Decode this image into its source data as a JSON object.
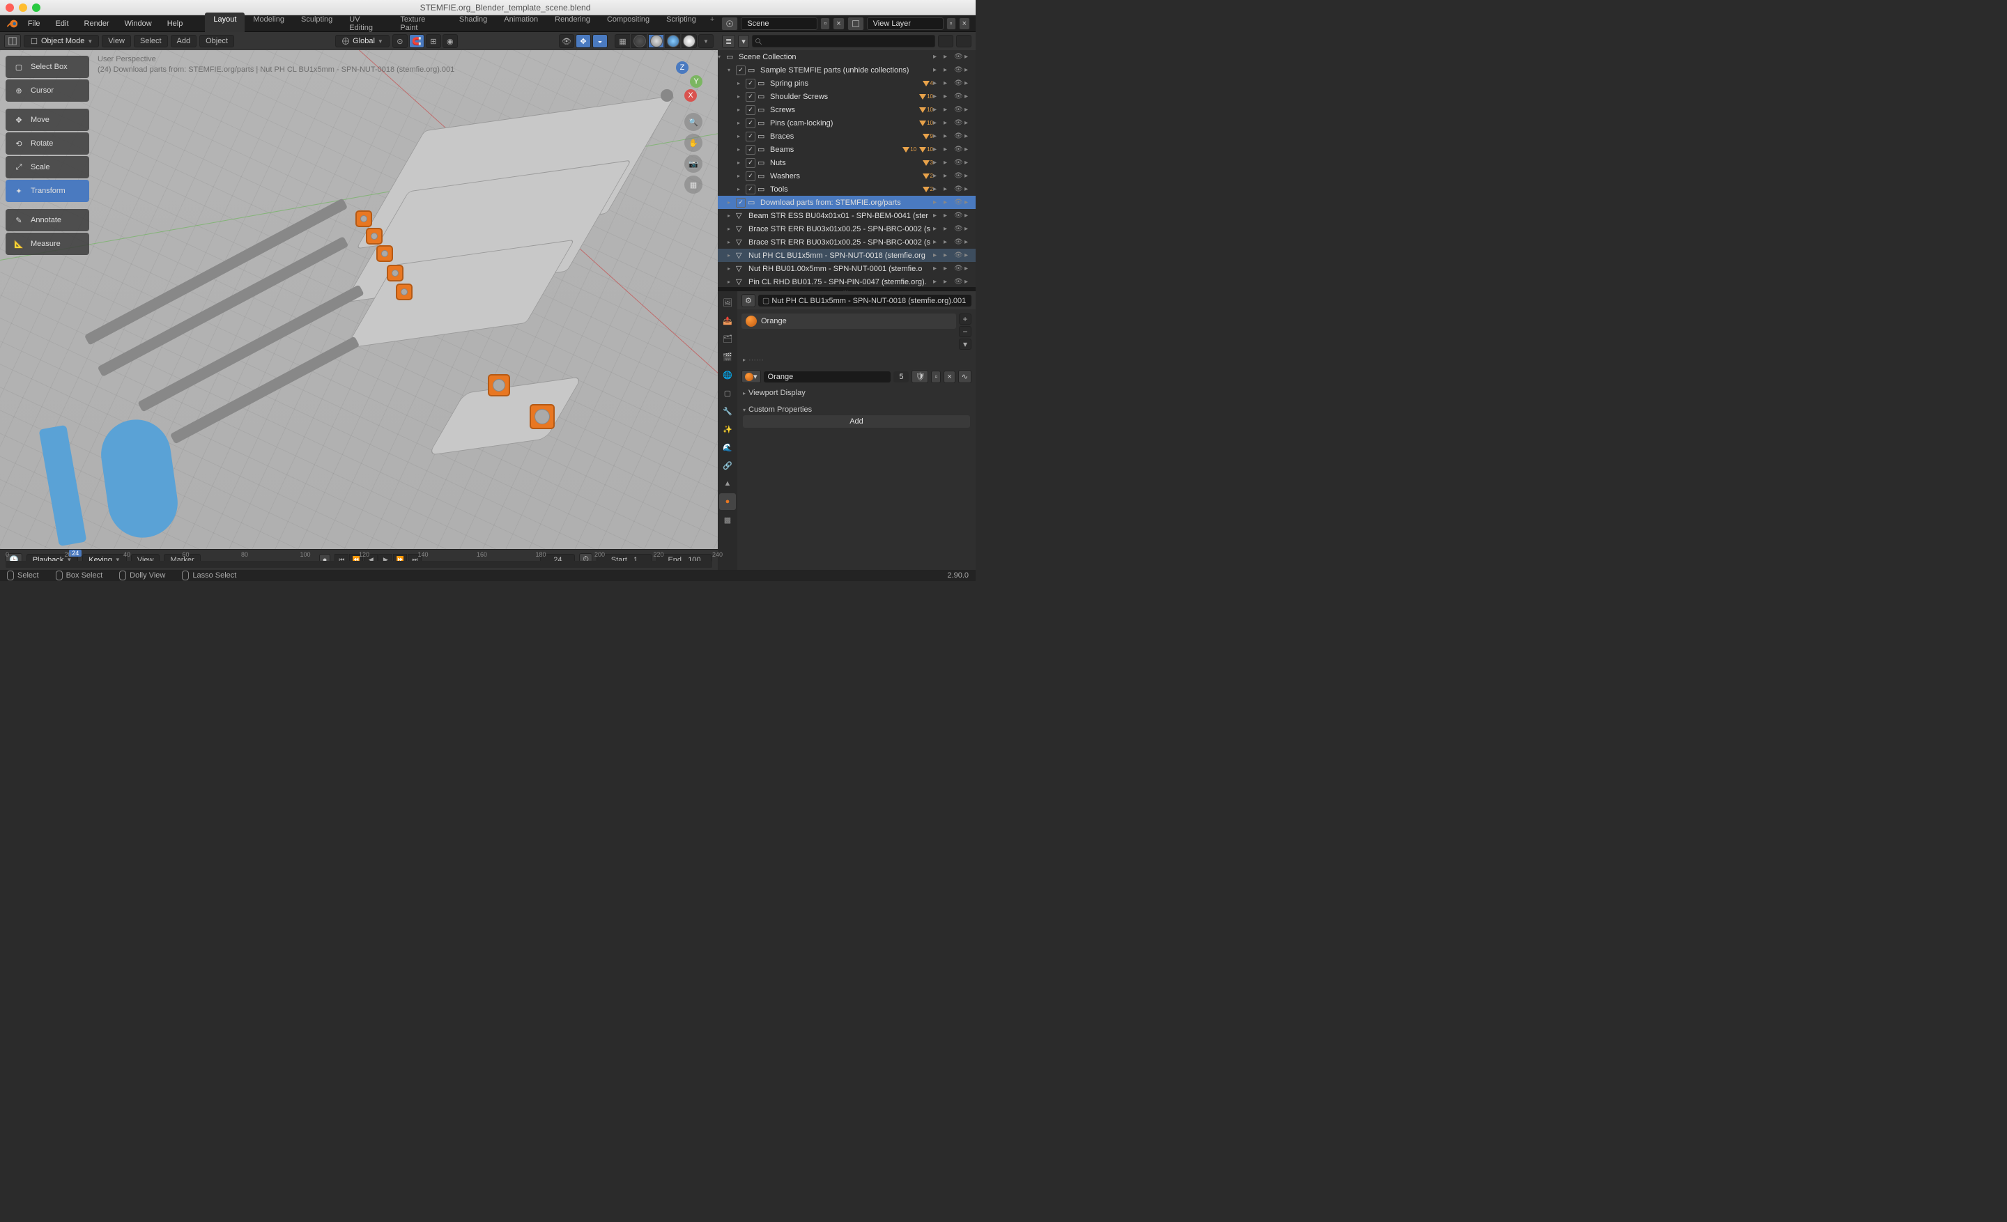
{
  "title": "STEMFIE.org_Blender_template_scene.blend",
  "menu": [
    "File",
    "Edit",
    "Render",
    "Window",
    "Help"
  ],
  "workspaces": {
    "items": [
      "Layout",
      "Modeling",
      "Sculpting",
      "UV Editing",
      "Texture Paint",
      "Shading",
      "Animation",
      "Rendering",
      "Compositing",
      "Scripting"
    ],
    "active": "Layout",
    "add": "+"
  },
  "scene": {
    "label": "Scene"
  },
  "viewlayer": {
    "label": "View Layer"
  },
  "viewport_header": {
    "mode": "Object Mode",
    "view": "View",
    "select": "Select",
    "add": "Add",
    "object": "Object",
    "orientation": "Global"
  },
  "overlay": {
    "line1": "User Perspective",
    "line2": "(24) Download parts from: STEMFIE.org/parts | Nut PH CL BU1x5mm - SPN-NUT-0018 (stemfie.org).001"
  },
  "tools": {
    "select_box": "Select Box",
    "cursor": "Cursor",
    "move": "Move",
    "rotate": "Rotate",
    "scale": "Scale",
    "transform": "Transform",
    "annotate": "Annotate",
    "measure": "Measure"
  },
  "gizmo": {
    "x": "X",
    "y": "Y",
    "z": "Z"
  },
  "timeline": {
    "playback": "Playback",
    "keying": "Keying",
    "view": "View",
    "marker": "Marker",
    "current": "24",
    "start_label": "Start",
    "start": "1",
    "end_label": "End",
    "end": "100",
    "ticks": [
      "0",
      "20",
      "40",
      "60",
      "80",
      "100",
      "120",
      "140",
      "160",
      "180",
      "200",
      "220",
      "240"
    ]
  },
  "status": {
    "select": "Select",
    "box": "Box Select",
    "dolly": "Dolly View",
    "lasso": "Lasso Select",
    "version": "2.90.0"
  },
  "outliner": {
    "root": "Scene Collection",
    "sample": "Sample STEMFIE parts (unhide collections)",
    "collections": [
      {
        "label": "Spring pins",
        "count": "4"
      },
      {
        "label": "Shoulder Screws",
        "count": "10"
      },
      {
        "label": "Screws",
        "count": "10"
      },
      {
        "label": "Pins (cam-locking)",
        "count": "10"
      },
      {
        "label": "Braces",
        "count": "9"
      },
      {
        "label": "Beams",
        "count": "10",
        "double": true
      },
      {
        "label": "Nuts",
        "count": "3"
      },
      {
        "label": "Washers",
        "count": "2"
      },
      {
        "label": "Tools",
        "count": "2"
      }
    ],
    "download": "Download parts from: STEMFIE.org/parts",
    "objects": [
      "Beam STR ESS BU04x01x01 - SPN-BEM-0041 (ster",
      "Brace STR ERR BU03x01x00.25 - SPN-BRC-0002 (s",
      "Brace STR ERR BU03x01x00.25 - SPN-BRC-0002 (s",
      "Nut PH CL BU1x5mm - SPN-NUT-0018 (stemfie.org",
      "Nut RH BU01.00x5mm - SPN-NUT-0001 (stemfie.o",
      "Pin CL RHD BU01.75 - SPN-PIN-0047 (stemfie.org)."
    ],
    "selected_obj_index": 3
  },
  "properties": {
    "breadcrumb": "Nut PH CL BU1x5mm - SPN-NUT-0018 (stemfie.org).001",
    "material_name": "Orange",
    "material_users": "5",
    "viewport_display": "Viewport Display",
    "custom_props": "Custom Properties",
    "add": "Add"
  }
}
